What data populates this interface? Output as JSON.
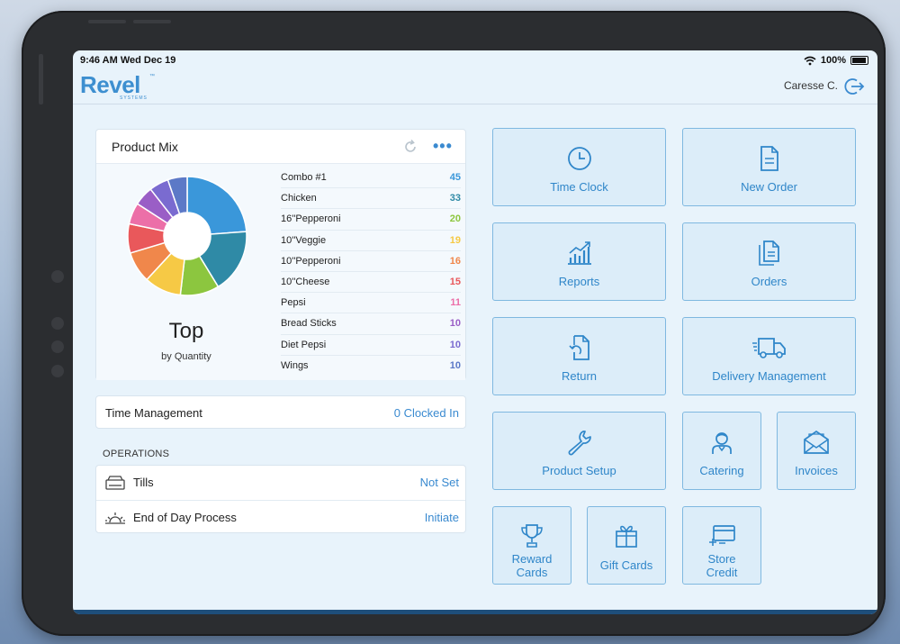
{
  "status_bar": {
    "time": "9:46 AM  Wed Dec 19",
    "battery": "100%"
  },
  "header": {
    "logo": "Revel",
    "logo_sub": "SYSTEMS",
    "logo_tm": "™",
    "user": "Caresse C."
  },
  "product_mix": {
    "title": "Product Mix",
    "more": "•••",
    "center_title": "Top",
    "center_sub": "by Quantity",
    "items": [
      {
        "name": "Combo #1",
        "value": "45",
        "color": "#3a97da"
      },
      {
        "name": "Chicken",
        "value": "33",
        "color": "#2f8aa6"
      },
      {
        "name": "16''Pepperoni",
        "value": "20",
        "color": "#8cc63f"
      },
      {
        "name": "10''Veggie",
        "value": "19",
        "color": "#f6c945"
      },
      {
        "name": "10''Pepperoni",
        "value": "16",
        "color": "#f0874b"
      },
      {
        "name": "10''Cheese",
        "value": "15",
        "color": "#e9585b"
      },
      {
        "name": "Pepsi",
        "value": "11",
        "color": "#ec6fa8"
      },
      {
        "name": "Bread Sticks",
        "value": "10",
        "color": "#9a5ec6"
      },
      {
        "name": "Diet Pepsi",
        "value": "10",
        "color": "#7a6bd0"
      },
      {
        "name": "Wings",
        "value": "10",
        "color": "#5c79c7"
      }
    ]
  },
  "time_management": {
    "label": "Time Management",
    "value": "0 Clocked In"
  },
  "operations": {
    "title": "OPERATIONS",
    "tills": {
      "label": "Tills",
      "value": "Not Set"
    },
    "end_of_day": {
      "label": "End of Day Process",
      "value": "Initiate"
    }
  },
  "tiles": {
    "time_clock": "Time Clock",
    "new_order": "New Order",
    "reports": "Reports",
    "orders": "Orders",
    "return": "Return",
    "delivery_management": "Delivery Management",
    "product_setup": "Product Setup",
    "catering": "Catering",
    "invoices": "Invoices",
    "reward_cards_1": "Reward",
    "reward_cards_2": "Cards",
    "gift_cards": "Gift Cards",
    "store_credit_1": "Store",
    "store_credit_2": "Credit"
  }
}
